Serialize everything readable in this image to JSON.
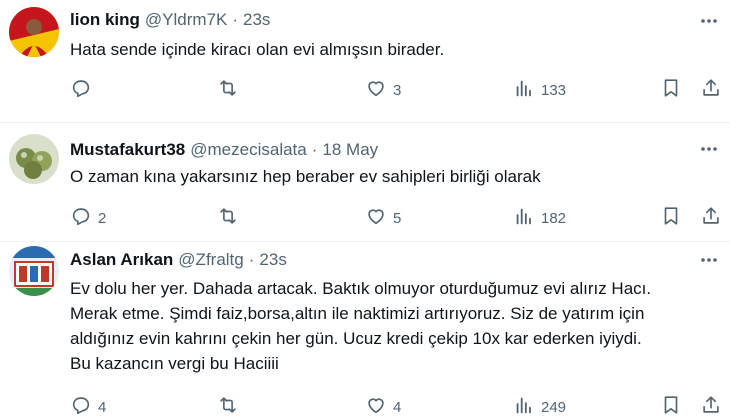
{
  "tweets": [
    {
      "name": "lion king",
      "handle": "@Yldrm7K",
      "sep": "·",
      "time": "23s",
      "lines": [
        "Hata sende içinde kiracı olan evi almışsın birader."
      ],
      "reply_count": "",
      "retweet_count": "",
      "like_count": "3",
      "view_count": "133",
      "avatar_colors": [
        "#c4161c",
        "#f5c400"
      ]
    },
    {
      "name": "Mustafakurt38",
      "handle": "@mezecisalata",
      "sep": "·",
      "time": "18 May",
      "lines": [
        "O zaman kına yakarsınız hep beraber ev sahipleri birliği olarak"
      ],
      "reply_count": "2",
      "retweet_count": "",
      "like_count": "5",
      "view_count": "182",
      "avatar_colors": [
        "#7a8c4a",
        "#c9d3b4"
      ]
    },
    {
      "name": "Aslan Arıkan",
      "handle": "@Zfraltg",
      "sep": "·",
      "time": "23s",
      "lines": [
        "Ev dolu her yer. Dahada artacak. Baktık olmuyor oturduğumuz evi alırız Hacı.",
        "Merak etme. Şimdi faiz,borsa,altın ile naktimizi artırıyoruz. Siz de yatırım için",
        "aldığınız evin kahrını çekin her gün. Ucuz kredi çekip 10x kar ederken iyiydi.",
        "Bu kazancın vergi bu Haciiii"
      ],
      "reply_count": "4",
      "retweet_count": "",
      "like_count": "4",
      "view_count": "249",
      "avatar_colors": [
        "#2b6cb0",
        "#c0392b"
      ]
    }
  ]
}
